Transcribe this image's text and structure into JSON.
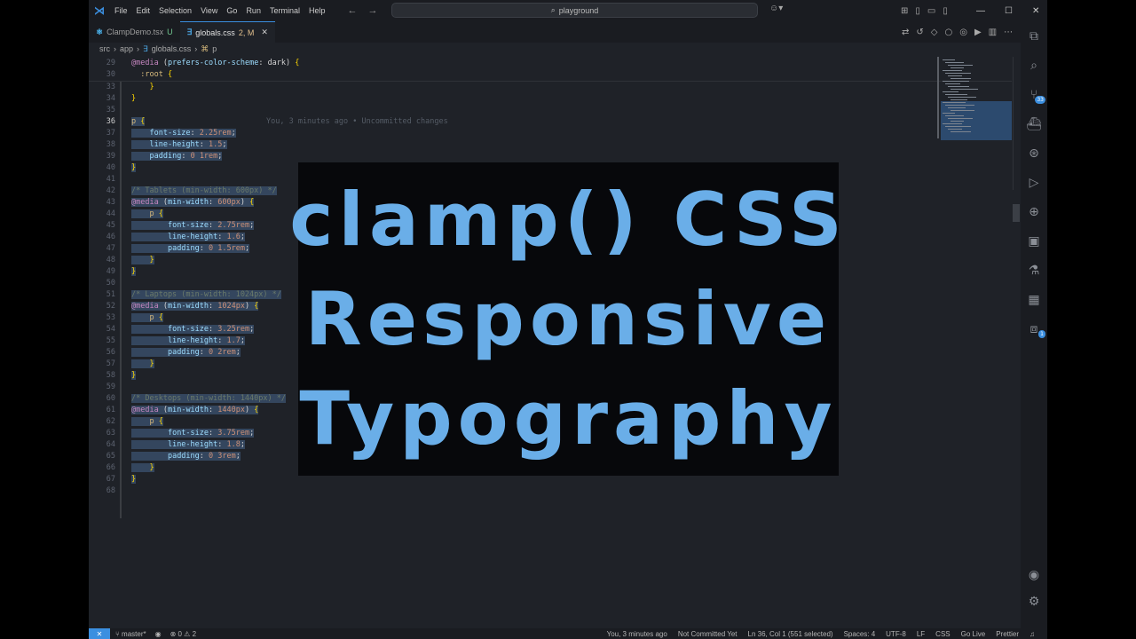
{
  "app": {
    "menu": [
      "File",
      "Edit",
      "Selection",
      "View",
      "Go",
      "Run",
      "Terminal",
      "Help"
    ],
    "search": "playground"
  },
  "tabs": [
    {
      "name": "ClampDemo.tsx",
      "status": "U",
      "active": false
    },
    {
      "name": "globals.css",
      "status": "2, M",
      "active": true
    }
  ],
  "breadcrumb": [
    "src",
    "app",
    "globals.css",
    "p"
  ],
  "sticky": [
    {
      "n": "29",
      "code": "@media (prefers-color-scheme: dark) {"
    },
    {
      "n": "30",
      "code": "  :root {"
    }
  ],
  "lines": [
    {
      "n": "33",
      "code": "    }"
    },
    {
      "n": "34",
      "code": "}"
    },
    {
      "n": "35",
      "code": ""
    },
    {
      "n": "36",
      "code": "p {",
      "blame": "You, 3 minutes ago • Uncommitted changes"
    },
    {
      "n": "37",
      "code": "    font-size: 2.25rem;"
    },
    {
      "n": "38",
      "code": "    line-height: 1.5;"
    },
    {
      "n": "39",
      "code": "    padding: 0 1rem;"
    },
    {
      "n": "40",
      "code": "}"
    },
    {
      "n": "41",
      "code": ""
    },
    {
      "n": "42",
      "code": "/* Tablets (min-width: 600px) */"
    },
    {
      "n": "43",
      "code": "@media (min-width: 600px) {"
    },
    {
      "n": "44",
      "code": "    p {"
    },
    {
      "n": "45",
      "code": "        font-size: 2.75rem;"
    },
    {
      "n": "46",
      "code": "        line-height: 1.6;"
    },
    {
      "n": "47",
      "code": "        padding: 0 1.5rem;"
    },
    {
      "n": "48",
      "code": "    }"
    },
    {
      "n": "49",
      "code": "}"
    },
    {
      "n": "50",
      "code": ""
    },
    {
      "n": "51",
      "code": "/* Laptops (min-width: 1024px) */"
    },
    {
      "n": "52",
      "code": "@media (min-width: 1024px) {"
    },
    {
      "n": "53",
      "code": "    p {"
    },
    {
      "n": "54",
      "code": "        font-size: 3.25rem;"
    },
    {
      "n": "55",
      "code": "        line-height: 1.7;"
    },
    {
      "n": "56",
      "code": "        padding: 0 2rem;"
    },
    {
      "n": "57",
      "code": "    }"
    },
    {
      "n": "58",
      "code": "}"
    },
    {
      "n": "59",
      "code": ""
    },
    {
      "n": "60",
      "code": "/* Desktops (min-width: 1440px) */"
    },
    {
      "n": "61",
      "code": "@media (min-width: 1440px) {"
    },
    {
      "n": "62",
      "code": "    p {"
    },
    {
      "n": "63",
      "code": "        font-size: 3.75rem;"
    },
    {
      "n": "64",
      "code": "        line-height: 1.8;"
    },
    {
      "n": "65",
      "code": "        padding: 0 3rem;"
    },
    {
      "n": "66",
      "code": "    }"
    },
    {
      "n": "67",
      "code": "}"
    },
    {
      "n": "68",
      "code": ""
    }
  ],
  "overlay": [
    "clamp() CSS",
    "Responsive",
    "Typography"
  ],
  "status": {
    "branch": "master*",
    "problems": "⊗ 0 ⚠ 2",
    "blame": "You, 3 minutes ago",
    "commit": "Not Committed Yet",
    "cursor": "Ln 36, Col 1 (551 selected)",
    "spaces": "Spaces: 4",
    "encoding": "UTF-8",
    "eol": "LF",
    "lang": "CSS",
    "golive": "Go Live",
    "prettier": "Prettier"
  },
  "activity_badges": {
    "scm": "33",
    "ext": "1"
  },
  "colors": {
    "accent": "#3b8fe0",
    "overlay_text": "#6aaee8",
    "overlay_bg": "#07080b"
  }
}
